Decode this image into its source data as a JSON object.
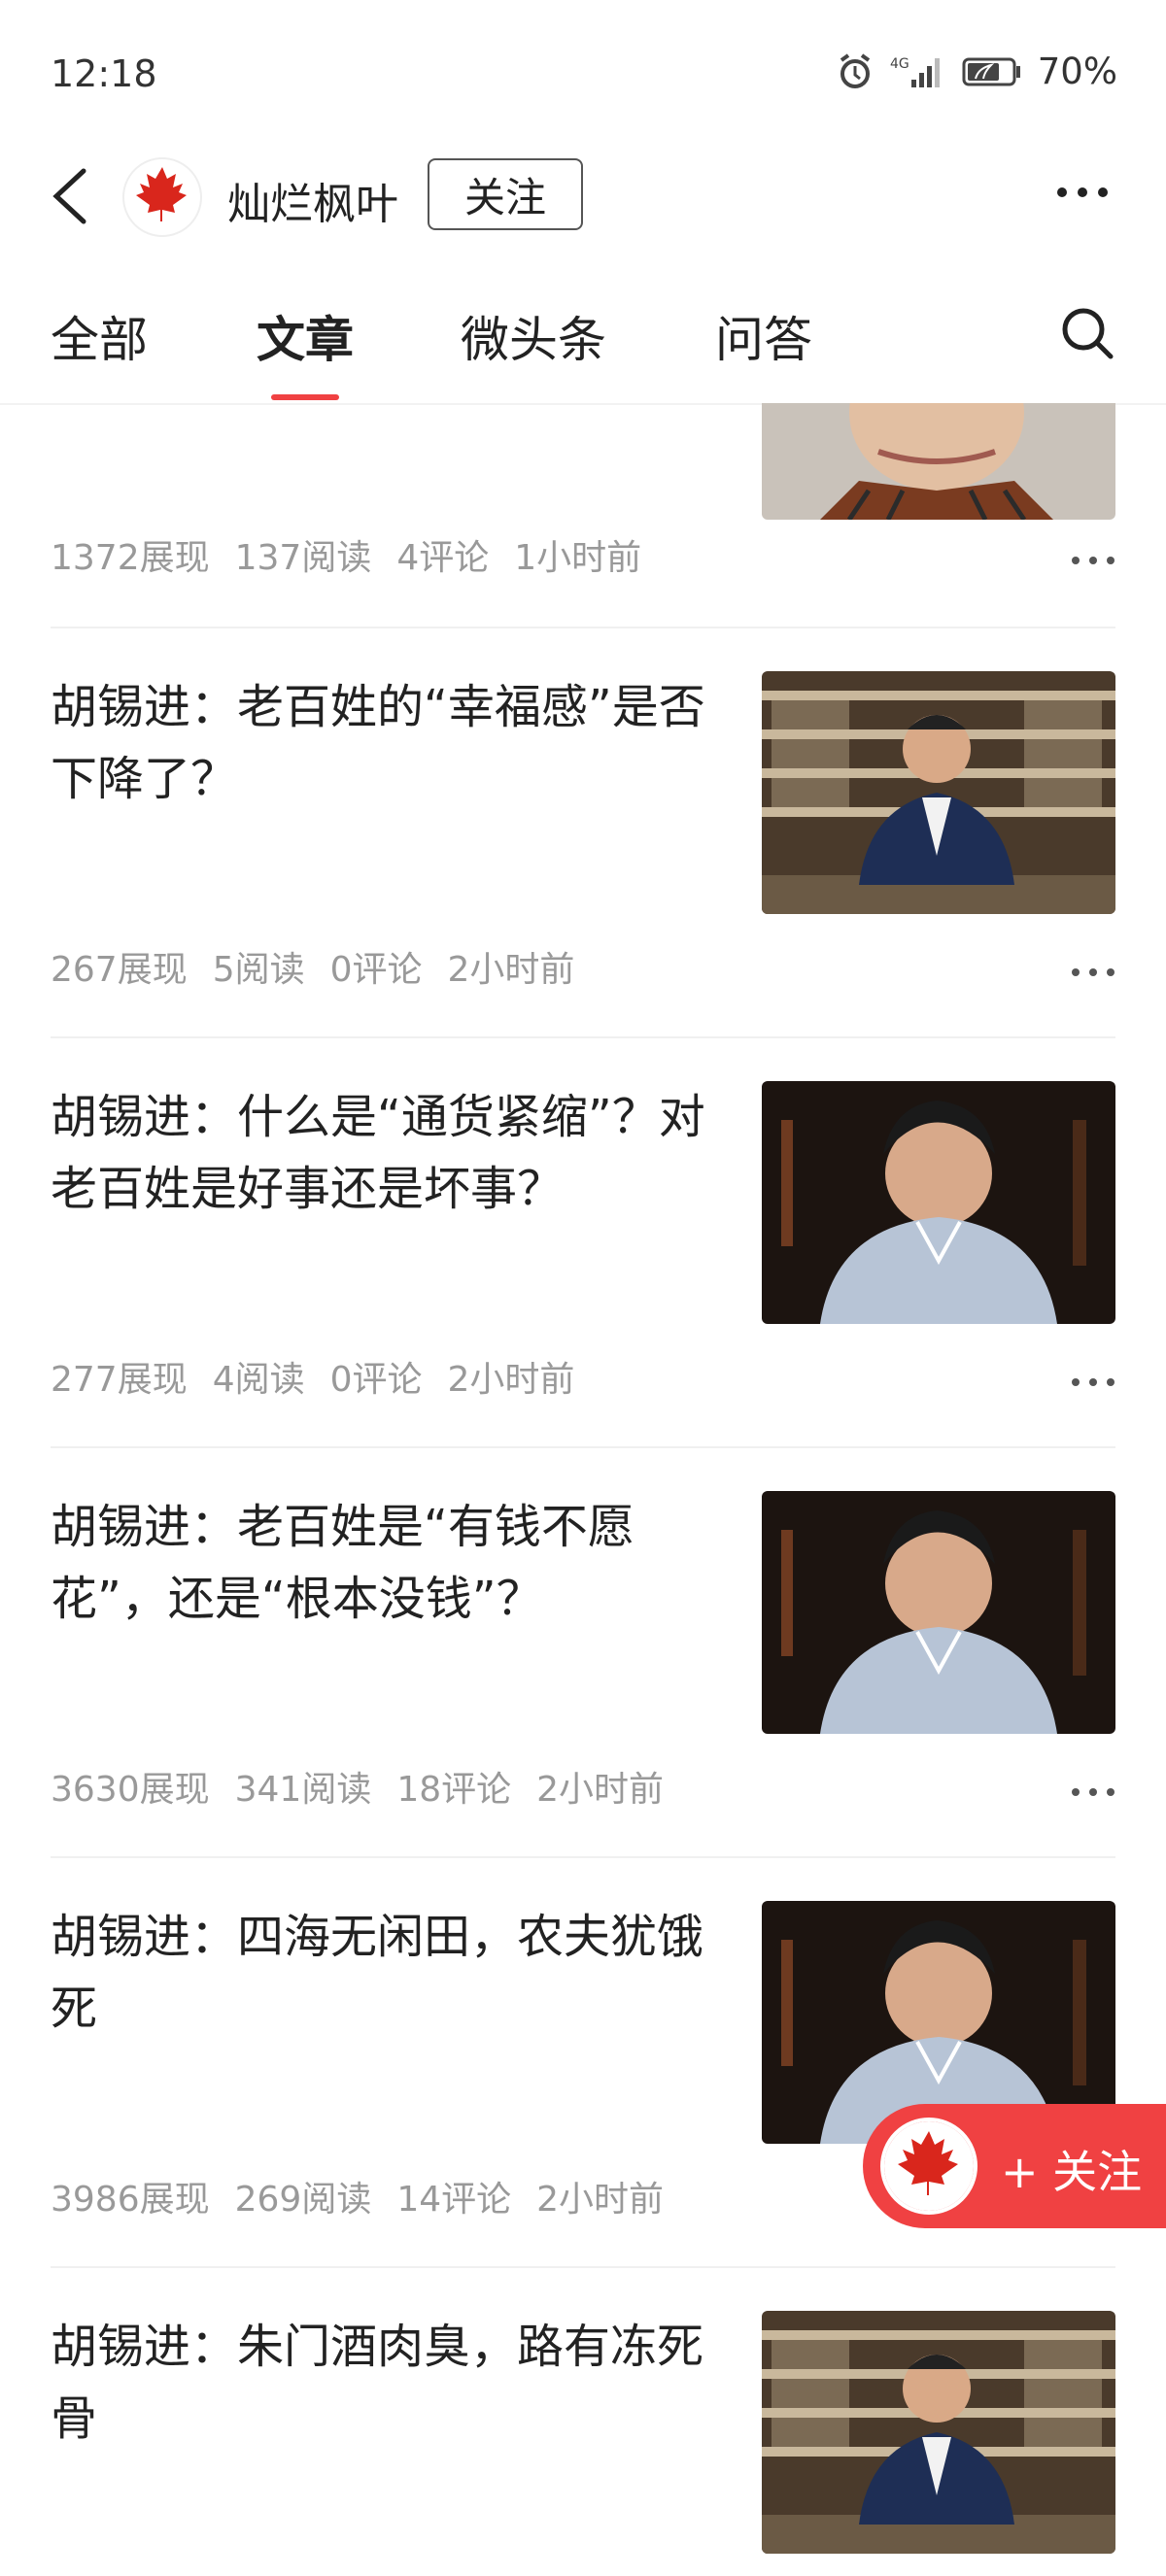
{
  "status": {
    "time": "12:18",
    "network": "4G",
    "battery": "70%"
  },
  "header": {
    "author": "灿烂枫叶",
    "follow_label": "关注"
  },
  "tabs": [
    {
      "label": "全部",
      "active": false
    },
    {
      "label": "文章",
      "active": true
    },
    {
      "label": "微头条",
      "active": false
    },
    {
      "label": "问答",
      "active": false
    }
  ],
  "articles": [
    {
      "title": "",
      "views": "1372展现",
      "reads": "137阅读",
      "comments": "4评论",
      "time": "1小时前"
    },
    {
      "title": "胡锡进：老百姓的“幸福感”是否下降了？",
      "views": "267展现",
      "reads": "5阅读",
      "comments": "0评论",
      "time": "2小时前"
    },
    {
      "title": "胡锡进：什么是“通货紧缩”？对老百姓是好事还是坏事？",
      "views": "277展现",
      "reads": "4阅读",
      "comments": "0评论",
      "time": "2小时前"
    },
    {
      "title": "胡锡进：老百姓是“有钱不愿花”，还是“根本没钱”？",
      "views": "3630展现",
      "reads": "341阅读",
      "comments": "18评论",
      "time": "2小时前"
    },
    {
      "title": "胡锡进：四海无闲田，农夫犹饿死",
      "views": "3986展现",
      "reads": "269阅读",
      "comments": "14评论",
      "time": "2小时前"
    },
    {
      "title": "胡锡进：朱门酒肉臭，路有冻死骨",
      "views": "",
      "reads": "",
      "comments": "",
      "time": ""
    }
  ],
  "float_follow": {
    "label": "+ 关注"
  },
  "colors": {
    "accent": "#f04142",
    "meta": "#999999"
  }
}
